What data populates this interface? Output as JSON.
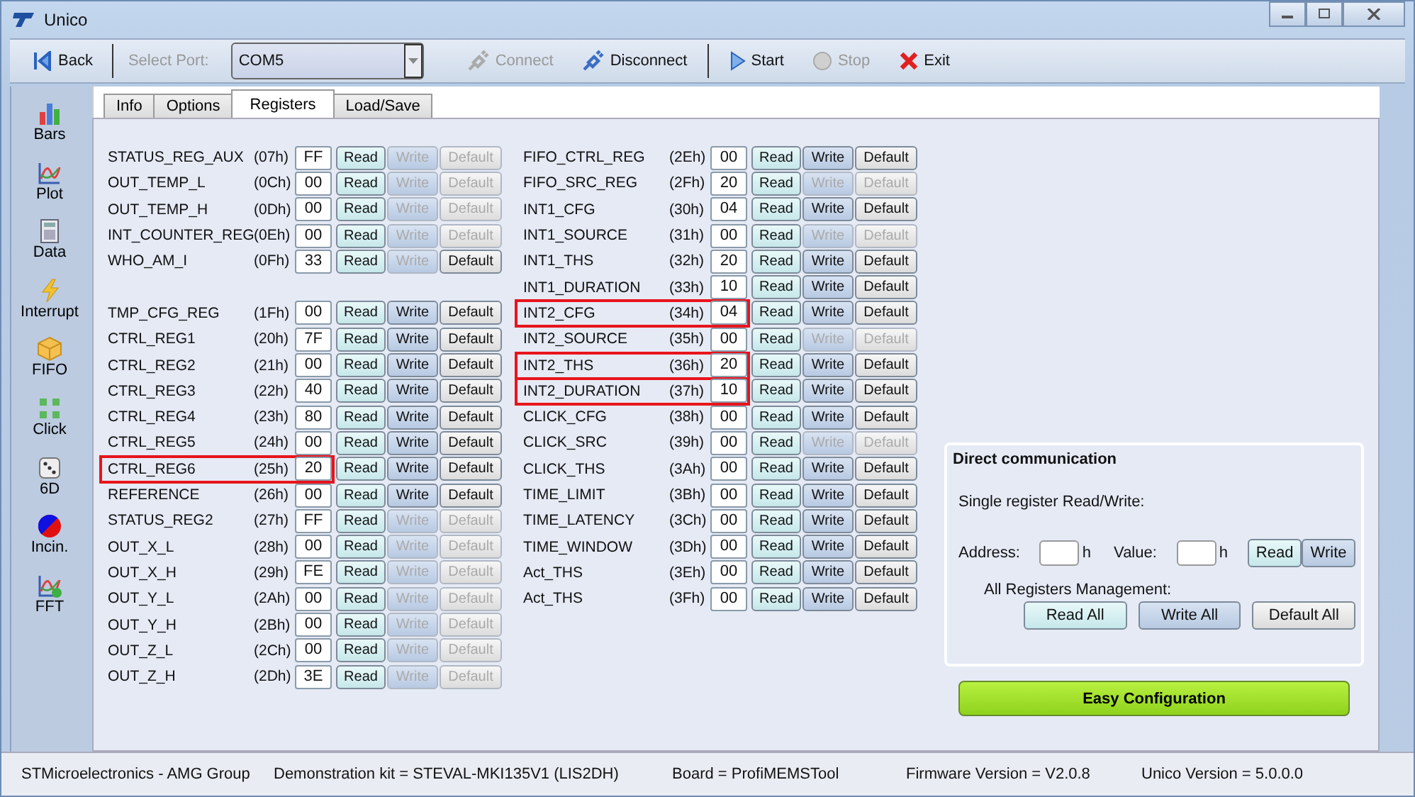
{
  "window": {
    "title": "Unico"
  },
  "toolbar": {
    "back": {
      "label": "Back"
    },
    "port": {
      "label": "Select Port:",
      "value": "COM5"
    },
    "buttons": [
      {
        "label": "Connect",
        "disabled": true
      },
      {
        "label": "Disconnect",
        "disabled": false
      },
      {
        "label": "Start",
        "disabled": false
      },
      {
        "label": "Stop",
        "disabled": true
      },
      {
        "label": "Exit",
        "disabled": false
      }
    ]
  },
  "sidebar": {
    "items": [
      {
        "label": "Bars"
      },
      {
        "label": "Plot"
      },
      {
        "label": "Data"
      },
      {
        "label": "Interrupt"
      },
      {
        "label": "FIFO"
      },
      {
        "label": "Click"
      },
      {
        "label": "6D"
      },
      {
        "label": "Incin."
      },
      {
        "label": "FFT"
      }
    ]
  },
  "tabs": [
    {
      "label": "Info",
      "selected": false
    },
    {
      "label": "Options",
      "selected": false
    },
    {
      "label": "Registers",
      "selected": true
    },
    {
      "label": "Load/Save",
      "selected": false
    }
  ],
  "left_groups": [
    [
      {
        "name": "STATUS_REG_AUX",
        "address": "(07h)",
        "value": "FF",
        "read": "Read",
        "write": "Write",
        "default": "Default",
        "write_disabled": true,
        "default_disabled": true,
        "highlighted": false
      },
      {
        "name": "OUT_TEMP_L",
        "address": "(0Ch)",
        "value": "00",
        "read": "Read",
        "write": "Write",
        "default": "Default",
        "write_disabled": true,
        "default_disabled": true,
        "highlighted": false
      },
      {
        "name": "OUT_TEMP_H",
        "address": "(0Dh)",
        "value": "00",
        "read": "Read",
        "write": "Write",
        "default": "Default",
        "write_disabled": true,
        "default_disabled": true,
        "highlighted": false
      },
      {
        "name": "INT_COUNTER_REG",
        "address": "(0Eh)",
        "value": "00",
        "read": "Read",
        "write": "Write",
        "default": "Default",
        "write_disabled": true,
        "default_disabled": true,
        "highlighted": false
      },
      {
        "name": "WHO_AM_I",
        "address": "(0Fh)",
        "value": "33",
        "read": "Read",
        "write": "Write",
        "default": "Default",
        "write_disabled": true,
        "default_disabled": false,
        "highlighted": false
      }
    ],
    [
      {
        "name": "TMP_CFG_REG",
        "address": "(1Fh)",
        "value": "00",
        "read": "Read",
        "write": "Write",
        "default": "Default",
        "write_disabled": false,
        "default_disabled": false,
        "highlighted": false
      },
      {
        "name": "CTRL_REG1",
        "address": "(20h)",
        "value": "7F",
        "read": "Read",
        "write": "Write",
        "default": "Default",
        "write_disabled": false,
        "default_disabled": false,
        "highlighted": false
      },
      {
        "name": "CTRL_REG2",
        "address": "(21h)",
        "value": "00",
        "read": "Read",
        "write": "Write",
        "default": "Default",
        "write_disabled": false,
        "default_disabled": false,
        "highlighted": false
      },
      {
        "name": "CTRL_REG3",
        "address": "(22h)",
        "value": "40",
        "read": "Read",
        "write": "Write",
        "default": "Default",
        "write_disabled": false,
        "default_disabled": false,
        "highlighted": false
      },
      {
        "name": "CTRL_REG4",
        "address": "(23h)",
        "value": "80",
        "read": "Read",
        "write": "Write",
        "default": "Default",
        "write_disabled": false,
        "default_disabled": false,
        "highlighted": false
      },
      {
        "name": "CTRL_REG5",
        "address": "(24h)",
        "value": "00",
        "read": "Read",
        "write": "Write",
        "default": "Default",
        "write_disabled": false,
        "default_disabled": false,
        "highlighted": false
      },
      {
        "name": "CTRL_REG6",
        "address": "(25h)",
        "value": "20",
        "read": "Read",
        "write": "Write",
        "default": "Default",
        "write_disabled": false,
        "default_disabled": false,
        "highlighted": true
      },
      {
        "name": "REFERENCE",
        "address": "(26h)",
        "value": "00",
        "read": "Read",
        "write": "Write",
        "default": "Default",
        "write_disabled": false,
        "default_disabled": false,
        "highlighted": false
      },
      {
        "name": "STATUS_REG2",
        "address": "(27h)",
        "value": "FF",
        "read": "Read",
        "write": "Write",
        "default": "Default",
        "write_disabled": true,
        "default_disabled": true,
        "highlighted": false
      },
      {
        "name": "OUT_X_L",
        "address": "(28h)",
        "value": "00",
        "read": "Read",
        "write": "Write",
        "default": "Default",
        "write_disabled": true,
        "default_disabled": true,
        "highlighted": false
      },
      {
        "name": "OUT_X_H",
        "address": "(29h)",
        "value": "FE",
        "read": "Read",
        "write": "Write",
        "default": "Default",
        "write_disabled": true,
        "default_disabled": true,
        "highlighted": false
      },
      {
        "name": "OUT_Y_L",
        "address": "(2Ah)",
        "value": "00",
        "read": "Read",
        "write": "Write",
        "default": "Default",
        "write_disabled": true,
        "default_disabled": true,
        "highlighted": false
      },
      {
        "name": "OUT_Y_H",
        "address": "(2Bh)",
        "value": "00",
        "read": "Read",
        "write": "Write",
        "default": "Default",
        "write_disabled": true,
        "default_disabled": true,
        "highlighted": false
      },
      {
        "name": "OUT_Z_L",
        "address": "(2Ch)",
        "value": "00",
        "read": "Read",
        "write": "Write",
        "default": "Default",
        "write_disabled": true,
        "default_disabled": true,
        "highlighted": false
      },
      {
        "name": "OUT_Z_H",
        "address": "(2Dh)",
        "value": "3E",
        "read": "Read",
        "write": "Write",
        "default": "Default",
        "write_disabled": true,
        "default_disabled": true,
        "highlighted": false
      }
    ]
  ],
  "right_registers": [
    {
      "name": "FIFO_CTRL_REG",
      "address": "(2Eh)",
      "value": "00",
      "read": "Read",
      "write": "Write",
      "default": "Default",
      "write_disabled": false,
      "default_disabled": false,
      "highlighted": false
    },
    {
      "name": "FIFO_SRC_REG",
      "address": "(2Fh)",
      "value": "20",
      "read": "Read",
      "write": "Write",
      "default": "Default",
      "write_disabled": true,
      "default_disabled": true,
      "highlighted": false
    },
    {
      "name": "INT1_CFG",
      "address": "(30h)",
      "value": "04",
      "read": "Read",
      "write": "Write",
      "default": "Default",
      "write_disabled": false,
      "default_disabled": false,
      "highlighted": false
    },
    {
      "name": "INT1_SOURCE",
      "address": "(31h)",
      "value": "00",
      "read": "Read",
      "write": "Write",
      "default": "Default",
      "write_disabled": true,
      "default_disabled": true,
      "highlighted": false
    },
    {
      "name": "INT1_THS",
      "address": "(32h)",
      "value": "20",
      "read": "Read",
      "write": "Write",
      "default": "Default",
      "write_disabled": false,
      "default_disabled": false,
      "highlighted": false
    },
    {
      "name": "INT1_DURATION",
      "address": "(33h)",
      "value": "10",
      "read": "Read",
      "write": "Write",
      "default": "Default",
      "write_disabled": false,
      "default_disabled": false,
      "highlighted": false
    },
    {
      "name": "INT2_CFG",
      "address": "(34h)",
      "value": "04",
      "read": "Read",
      "write": "Write",
      "default": "Default",
      "write_disabled": false,
      "default_disabled": false,
      "highlighted": true
    },
    {
      "name": "INT2_SOURCE",
      "address": "(35h)",
      "value": "00",
      "read": "Read",
      "write": "Write",
      "default": "Default",
      "write_disabled": true,
      "default_disabled": true,
      "highlighted": false
    },
    {
      "name": "INT2_THS",
      "address": "(36h)",
      "value": "20",
      "read": "Read",
      "write": "Write",
      "default": "Default",
      "write_disabled": false,
      "default_disabled": false,
      "highlighted": true
    },
    {
      "name": "INT2_DURATION",
      "address": "(37h)",
      "value": "10",
      "read": "Read",
      "write": "Write",
      "default": "Default",
      "write_disabled": false,
      "default_disabled": false,
      "highlighted": true
    },
    {
      "name": "CLICK_CFG",
      "address": "(38h)",
      "value": "00",
      "read": "Read",
      "write": "Write",
      "default": "Default",
      "write_disabled": false,
      "default_disabled": false,
      "highlighted": false
    },
    {
      "name": "CLICK_SRC",
      "address": "(39h)",
      "value": "00",
      "read": "Read",
      "write": "Write",
      "default": "Default",
      "write_disabled": true,
      "default_disabled": true,
      "highlighted": false
    },
    {
      "name": "CLICK_THS",
      "address": "(3Ah)",
      "value": "00",
      "read": "Read",
      "write": "Write",
      "default": "Default",
      "write_disabled": false,
      "default_disabled": false,
      "highlighted": false
    },
    {
      "name": "TIME_LIMIT",
      "address": "(3Bh)",
      "value": "00",
      "read": "Read",
      "write": "Write",
      "default": "Default",
      "write_disabled": false,
      "default_disabled": false,
      "highlighted": false
    },
    {
      "name": "TIME_LATENCY",
      "address": "(3Ch)",
      "value": "00",
      "read": "Read",
      "write": "Write",
      "default": "Default",
      "write_disabled": false,
      "default_disabled": false,
      "highlighted": false
    },
    {
      "name": "TIME_WINDOW",
      "address": "(3Dh)",
      "value": "00",
      "read": "Read",
      "write": "Write",
      "default": "Default",
      "write_disabled": false,
      "default_disabled": false,
      "highlighted": false
    },
    {
      "name": "Act_THS",
      "address": "(3Eh)",
      "value": "00",
      "read": "Read",
      "write": "Write",
      "default": "Default",
      "write_disabled": false,
      "default_disabled": false,
      "highlighted": false
    },
    {
      "name": "Act_THS",
      "address": "(3Fh)",
      "value": "00",
      "read": "Read",
      "write": "Write",
      "default": "Default",
      "write_disabled": false,
      "default_disabled": false,
      "highlighted": false
    }
  ],
  "direct_communication": {
    "title": "Direct communication",
    "single_label": "Single register Read/Write:",
    "address_label": "Address:",
    "address_suffix": "h",
    "value_label": "Value:",
    "value_suffix": "h",
    "read": "Read",
    "write": "Write",
    "all_label": "All Registers Management:",
    "read_all": "Read All",
    "write_all": "Write All",
    "default_all": "Default All"
  },
  "easy_configuration": "Easy Configuration",
  "status_bar": [
    "STMicroelectronics - AMG Group",
    "Demonstration kit = STEVAL-MKI135V1 (LIS2DH)",
    "Board = ProfiMEMSTool",
    "Firmware Version = V2.0.8",
    "Unico Version = 5.0.0.0"
  ]
}
